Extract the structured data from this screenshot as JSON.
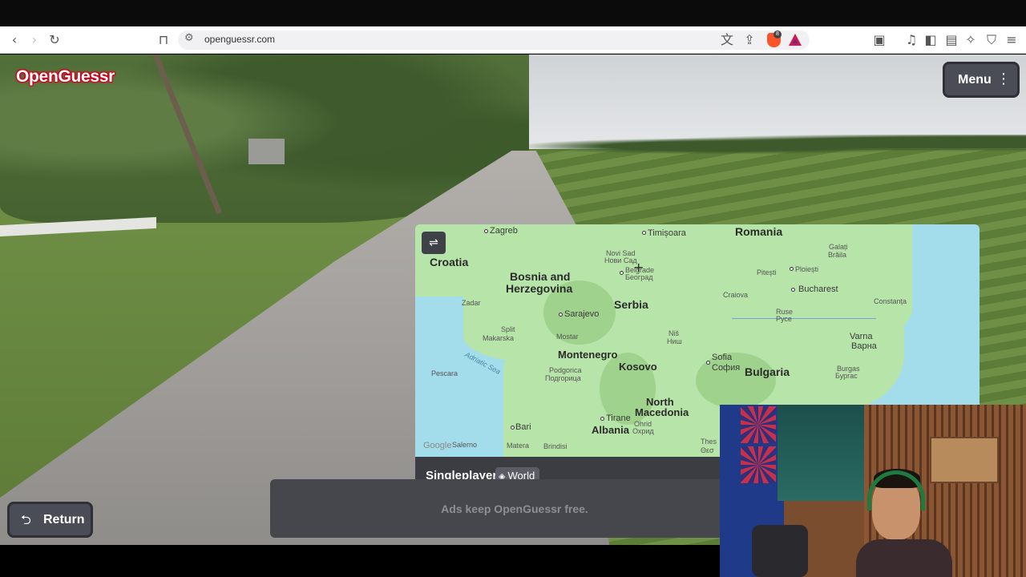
{
  "browser": {
    "url": "openguessr.com",
    "brave_badge": "8"
  },
  "game": {
    "logo": "OpenGuessr",
    "menu_label": "Menu",
    "return_label": "Return",
    "mode_label": "Singleplayer",
    "map_scope": "World",
    "ads_text": "Ads keep OpenGuessr free."
  },
  "map": {
    "countries": {
      "croatia": "Croatia",
      "bosnia_1": "Bosnia and",
      "bosnia_2": "Herzegovina",
      "serbia": "Serbia",
      "romania": "Romania",
      "montenegro": "Montenegro",
      "kosovo": "Kosovo",
      "north_mac_1": "North",
      "north_mac_2": "Macedonia",
      "albania": "Albania",
      "bulgaria": "Bulgaria"
    },
    "cities": {
      "zagreb": "Zagreb",
      "timisoara": "Timișoara",
      "novi_sad_1": "Novi Sad",
      "novi_sad_2": "Нови Сад",
      "belgrade_1": "Belgrade",
      "belgrade_2": "Београд",
      "galati": "Galați",
      "braila": "Brăila",
      "ploiesti": "Ploiești",
      "pitesti": "Pitești",
      "bucharest": "Bucharest",
      "craiova": "Craiova",
      "zadar": "Zadar",
      "sarajevo": "Sarajevo",
      "ruse_1": "Ruse",
      "ruse_2": "Русе",
      "constanta": "Constanța",
      "split_1": "Split",
      "split_2": "Makarska",
      "mostar": "Mostar",
      "nis_1": "Niš",
      "nis_2": "Ниш",
      "varna_1": "Varna",
      "varna_2": "Варна",
      "sofia_1": "Sofia",
      "sofia_2": "София",
      "pescara": "Pescara",
      "podgorica_1": "Podgorica",
      "podgorica_2": "Подгорица",
      "burgas_1": "Burgas",
      "burgas_2": "Бургас",
      "tirane": "Tirane",
      "ohrid_1": "Ohrid",
      "ohrid_2": "Охрид",
      "bari": "Bari",
      "matera": "Matera",
      "brindisi": "Brindisi",
      "salerno": "Salerno",
      "thes_1": "Thes",
      "thes_2": "Θεσ"
    },
    "sea": "Adriatic Sea",
    "attribution": "Google"
  }
}
